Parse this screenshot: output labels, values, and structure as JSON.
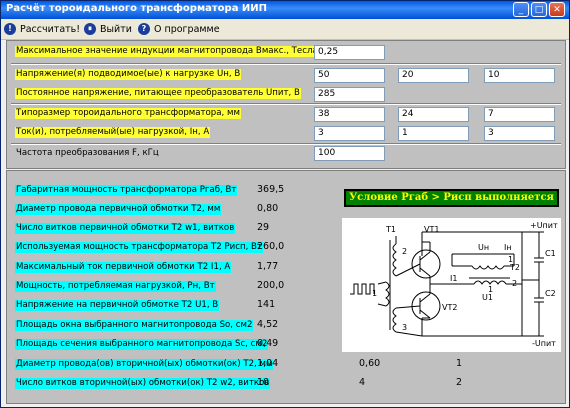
{
  "window": {
    "title": "Расчёт тороидального трансформатора ИИП",
    "minimize": "_",
    "maximize": "□",
    "close": "✕"
  },
  "menu": {
    "calculate": "Рассчитать!",
    "exit": "Выйти",
    "about": "О программе"
  },
  "inputs": {
    "induction": {
      "label": "Максимальное значение индукции магнитопровода Вмакс., Тесла",
      "values": [
        "0,25"
      ]
    },
    "voltage": {
      "label": "Напряжение(я) подводимое(ые) к нагрузке Uн, В",
      "values": [
        "50",
        "20",
        "10"
      ]
    },
    "dc_voltage": {
      "label": "Постоянное напряжение, питающее преобразователь Uпит, В",
      "values": [
        "285"
      ]
    },
    "size": {
      "label": "Типоразмер тороидального трансформатора, мм",
      "values": [
        "38",
        "24",
        "7"
      ]
    },
    "current": {
      "label": "Ток(и), потребляемый(ые) нагрузкой, Iн, А",
      "values": [
        "3",
        "1",
        "3"
      ]
    },
    "frequency": {
      "label": "Частота преобразования F, кГц",
      "values": [
        "100"
      ]
    }
  },
  "results": [
    {
      "label": "Габаритная мощность трансформатора Pгаб, Вт",
      "value": "369,5",
      "highlight": "cyan"
    },
    {
      "label": "Диаметр провода первичной обмотки Т2, мм",
      "value": "0,80",
      "highlight": "cyan"
    },
    {
      "label": "Число витков первичной обмотки Т2 w1, витков",
      "value": "29",
      "highlight": "cyan"
    },
    {
      "label": "Используемая мощность трансформатора Т2 Pисп, Вт",
      "value": "260,0",
      "highlight": "cyan"
    },
    {
      "label": "Максимальный ток первичной обмотки Т2 I1, А",
      "value": "1,77",
      "highlight": "cyan"
    },
    {
      "label": "Мощность, потребляемая нагрузкой, Pн, Вт",
      "value": "200,0",
      "highlight": "cyan"
    },
    {
      "label": "Напряжение на первичной обмотке Т2 U1, В",
      "value": "141",
      "highlight": "cyan"
    },
    {
      "label": "Площадь окна выбранного магнитопровода So, см2",
      "value": "4,52",
      "highlight": "cyan"
    },
    {
      "label": "Площадь сечения выбранного магнитопровода Sc, см2",
      "value": "0,49",
      "highlight": "cyan"
    },
    {
      "label": "Диаметр провода(ов) вторичной(ых) обмотки(ок) Т2, мм",
      "value": "1,04",
      "value2": "0,60",
      "value3": "1",
      "highlight": "cyan"
    },
    {
      "label": "Число витков вторичной(ых) обмотки(ок) Т2 w2, витков",
      "value": "10",
      "value2": "4",
      "value3": "2",
      "highlight": "cyan"
    }
  ],
  "status": "Условие Pгаб > Pисп выполняется",
  "schematic": {
    "labels": {
      "t1": "T1",
      "vt1": "VT1",
      "vt2": "VT2",
      "t2": "T2",
      "c1": "C1",
      "c2": "C2",
      "plus": "+Uпит",
      "minus": "-Uпит",
      "i1": "I1",
      "u1": "U1",
      "uh": "Uн",
      "ih": "Iн",
      "w1": "1",
      "w2": "2",
      "w3": "3",
      "w4": "1",
      "w5": "2",
      "w6": "1"
    }
  },
  "colors": {
    "label_yellow": "#ffff33",
    "label_cyan": "#00ffff",
    "status_bg": "#008000",
    "status_text": "#ffff00",
    "title_blue": "#0058e6"
  }
}
